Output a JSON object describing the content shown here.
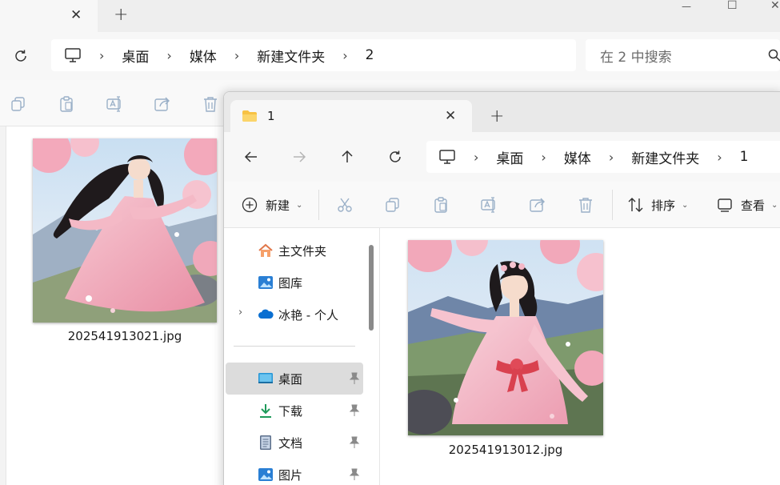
{
  "back_window": {
    "tab_close": "✕",
    "new_tab": "+",
    "window_controls": {
      "minimize": "—",
      "maximize": "☐",
      "close": "✕"
    },
    "breadcrumb": [
      "桌面",
      "媒体",
      "新建文件夹",
      "2"
    ],
    "search_placeholder": "在 2 中搜索",
    "files": [
      {
        "name": "202541913021.jpg"
      }
    ]
  },
  "front_window": {
    "tab_title": "1",
    "tab_close": "✕",
    "new_tab": "+",
    "breadcrumb": [
      "桌面",
      "媒体",
      "新建文件夹",
      "1"
    ],
    "toolbar": {
      "new_label": "新建",
      "sort_label": "排序",
      "view_label": "查看"
    },
    "sidebar": {
      "top_items": [
        {
          "label": "主文件夹",
          "icon": "home-icon"
        },
        {
          "label": "图库",
          "icon": "gallery-icon"
        },
        {
          "label": "冰艳 - 个人",
          "icon": "onedrive-icon"
        }
      ],
      "pinned_items": [
        {
          "label": "桌面",
          "icon": "desktop-icon"
        },
        {
          "label": "下载",
          "icon": "download-icon"
        },
        {
          "label": "文档",
          "icon": "document-icon"
        },
        {
          "label": "图片",
          "icon": "pictures-icon"
        }
      ]
    },
    "files": [
      {
        "name": "202541913012.jpg"
      }
    ]
  },
  "colors": {
    "accent_blue": "#0067c0",
    "folder_yellow": "#f7c244",
    "pink": "#f2b6c6"
  }
}
